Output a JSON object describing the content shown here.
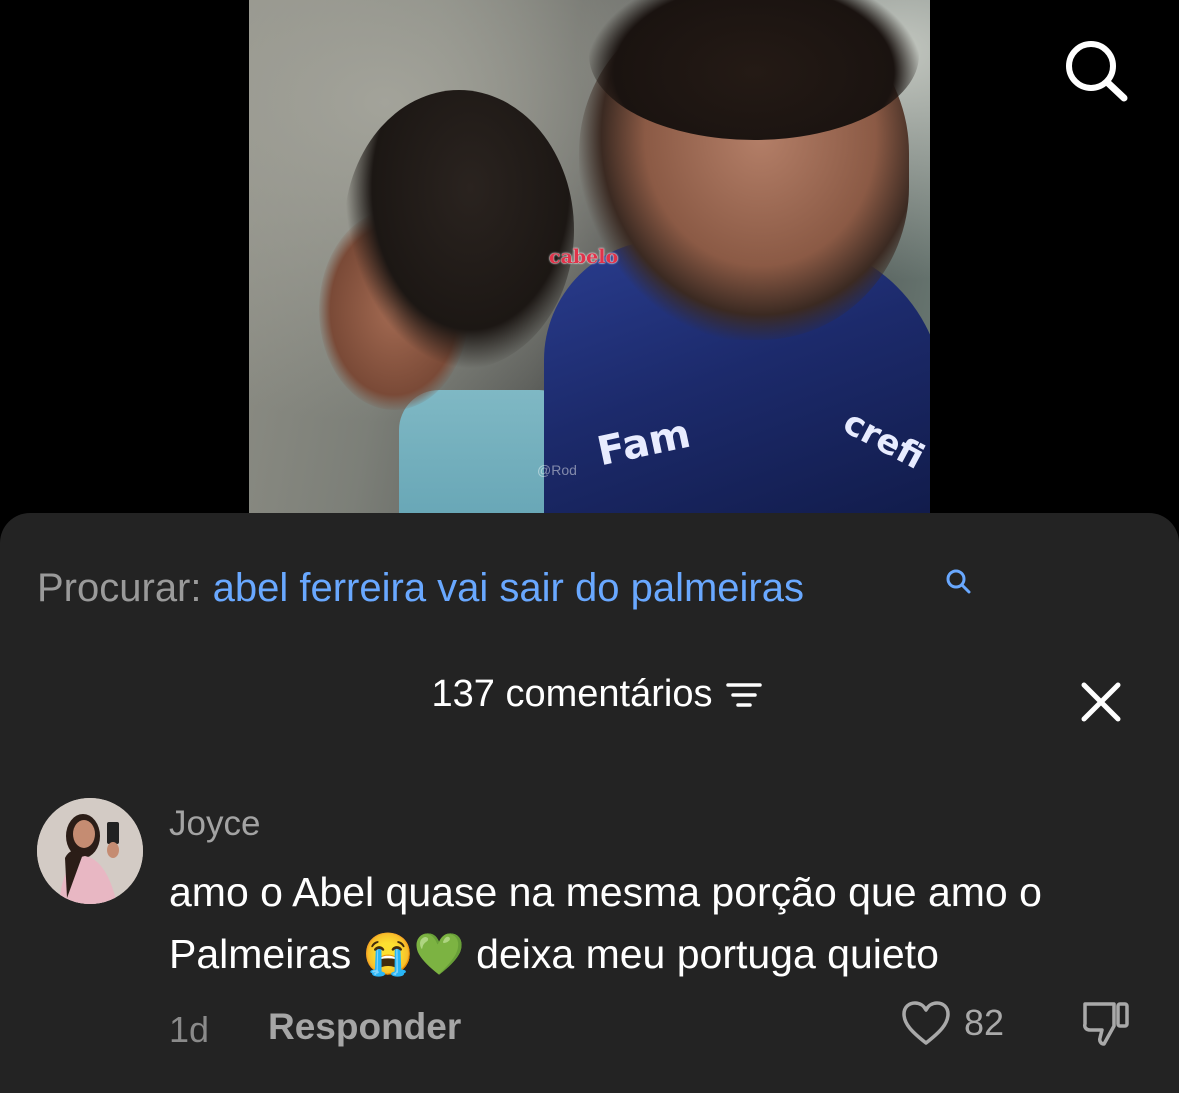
{
  "video": {
    "caption": "cabelo",
    "watermark": "@Rod",
    "jacket_sponsor_left": "Fam",
    "jacket_sponsor_right": "crefi"
  },
  "search_suggestion": {
    "label": "Procurar:",
    "query": "abel ferreira vai sair do palmeiras"
  },
  "comments_header": {
    "count_label": "137 comentários"
  },
  "comment": {
    "author": "Joyce",
    "text": "amo o Abel quase na mesma porção que amo o Palmeiras 😭💚 deixa meu portuga quieto",
    "time": "1d",
    "reply_label": "Responder",
    "likes": "82"
  },
  "icons": [
    "search-icon",
    "filter-icon",
    "close-icon",
    "heart-icon",
    "dislike-icon"
  ]
}
